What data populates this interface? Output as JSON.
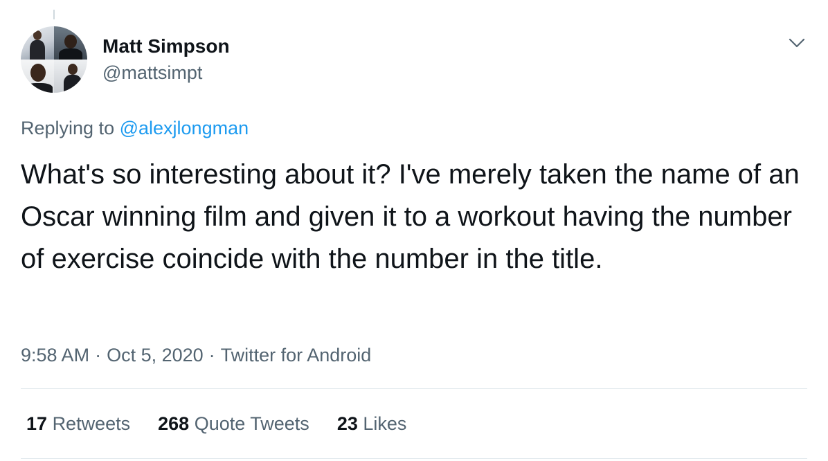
{
  "author": {
    "display_name": "Matt Simpson",
    "handle": "@mattsimpt",
    "avatar_icon": "collage-avatar-icon"
  },
  "menu_icon": "chevron-down-icon",
  "reply": {
    "prefix": "Replying to ",
    "mention": "@alexjlongman"
  },
  "tweet": {
    "text": "What's so interesting about it? I've merely taken the name of an Oscar winning film and given it to a workout having the number of exercise coincide with the number in the title."
  },
  "meta": {
    "time": "9:58 AM",
    "date": "Oct 5, 2020",
    "source": "Twitter for Android",
    "separator": "·"
  },
  "stats": {
    "retweets": {
      "count": "17",
      "label": "Retweets"
    },
    "quote_tweets": {
      "count": "268",
      "label": "Quote Tweets"
    },
    "likes": {
      "count": "23",
      "label": "Likes"
    }
  },
  "colors": {
    "link": "#1d9bf0",
    "secondary_text": "#536471",
    "primary_text": "#0f1419",
    "divider": "#e1e8ed"
  }
}
